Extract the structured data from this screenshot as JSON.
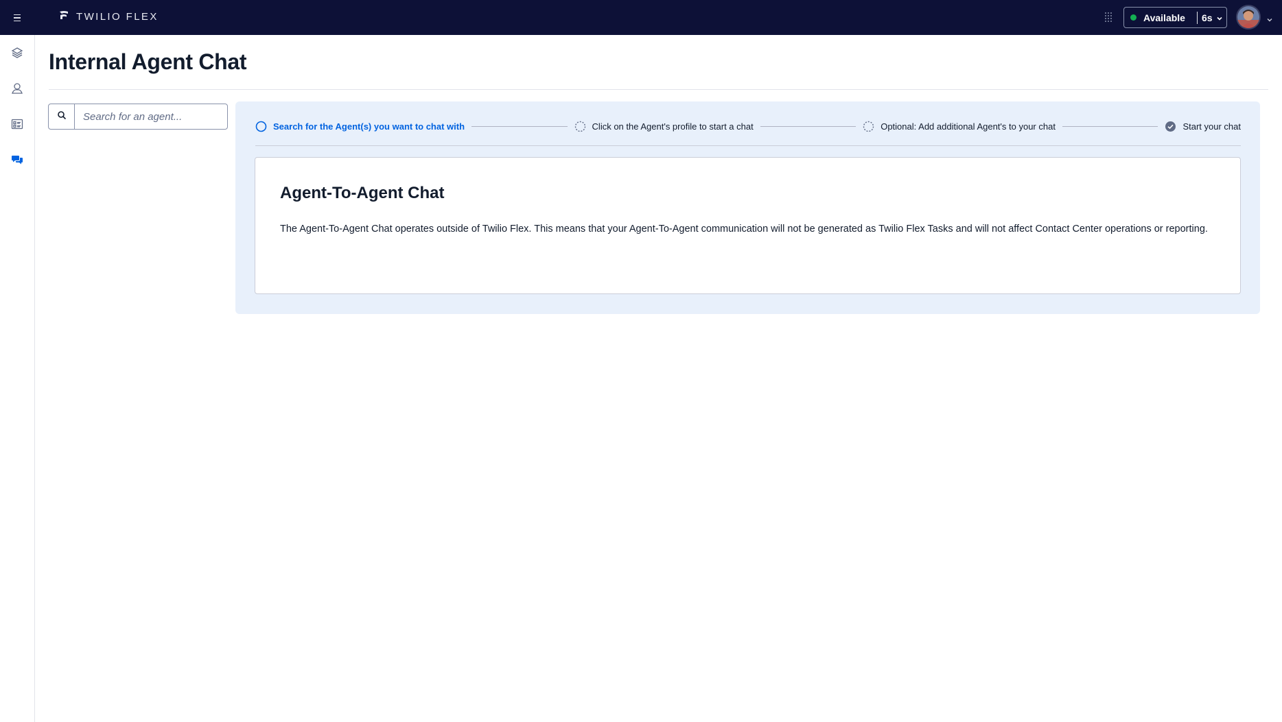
{
  "topbar": {
    "brand": "TWILIO FLEX",
    "status": {
      "label": "Available",
      "time": "6s",
      "color": "#14b053"
    }
  },
  "icons": {
    "menu": "hamburger-icon",
    "logo": "twilio-logo-icon",
    "apps": "dot-grid-icon",
    "status_chevron": "chevron-down-icon",
    "avatar_chevron": "chevron-down-icon",
    "rail": [
      "layers-icon",
      "contacts-icon",
      "teams-icon",
      "chat-bubbles-icon"
    ],
    "search": "search-icon"
  },
  "rail": {
    "active_index": 3,
    "active_color": "#0263e0"
  },
  "page": {
    "title": "Internal Agent Chat"
  },
  "search": {
    "placeholder": "Search for an agent..."
  },
  "steps": [
    {
      "label": "Search for the Agent(s) you want to chat with",
      "state": "active"
    },
    {
      "label": "Click on the Agent's profile to start a chat",
      "state": "pending"
    },
    {
      "label": "Optional: Add additional Agent's to your chat",
      "state": "pending"
    },
    {
      "label": "Start your chat",
      "state": "complete"
    }
  ],
  "card": {
    "title": "Agent-To-Agent Chat",
    "body": "The Agent-To-Agent Chat operates outside of Twilio Flex. This means that your Agent-To-Agent communication will not be generated as Twilio Flex Tasks and will not affect Contact Center operations or reporting."
  },
  "colors": {
    "topbar_bg": "#0d1137",
    "accent": "#0263e0",
    "panel_bg": "#e8f0fb"
  }
}
